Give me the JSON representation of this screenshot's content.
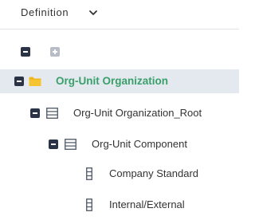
{
  "header": {
    "label": "Definition",
    "chevron_icon": "chevron-down-icon"
  },
  "toolbar": {
    "collapse_all_icon": "minus-square-icon",
    "expand_all_icon": "plus-square-icon"
  },
  "tree": [
    {
      "label": "Org-Unit Organization",
      "icon": "folder-icon",
      "toggle": "collapse",
      "selected": true,
      "level": 0
    },
    {
      "label": "Org-Unit Organization_Root",
      "icon": "table-icon",
      "toggle": "collapse",
      "selected": false,
      "level": 1
    },
    {
      "label": "Org-Unit Component",
      "icon": "table-icon",
      "toggle": "collapse",
      "selected": false,
      "level": 2
    },
    {
      "label": "Company Standard",
      "icon": "attribute-icon",
      "toggle": "none",
      "selected": false,
      "level": 3
    },
    {
      "label": "Internal/External",
      "icon": "attribute-icon",
      "toggle": "none",
      "selected": false,
      "level": 3
    }
  ],
  "colors": {
    "accent_green": "#39a06b",
    "dark_button": "#2b3447",
    "gray_button": "#b7bcc6",
    "folder_yellow": "#f2b71f",
    "selected_row": "#e4e8ef"
  }
}
